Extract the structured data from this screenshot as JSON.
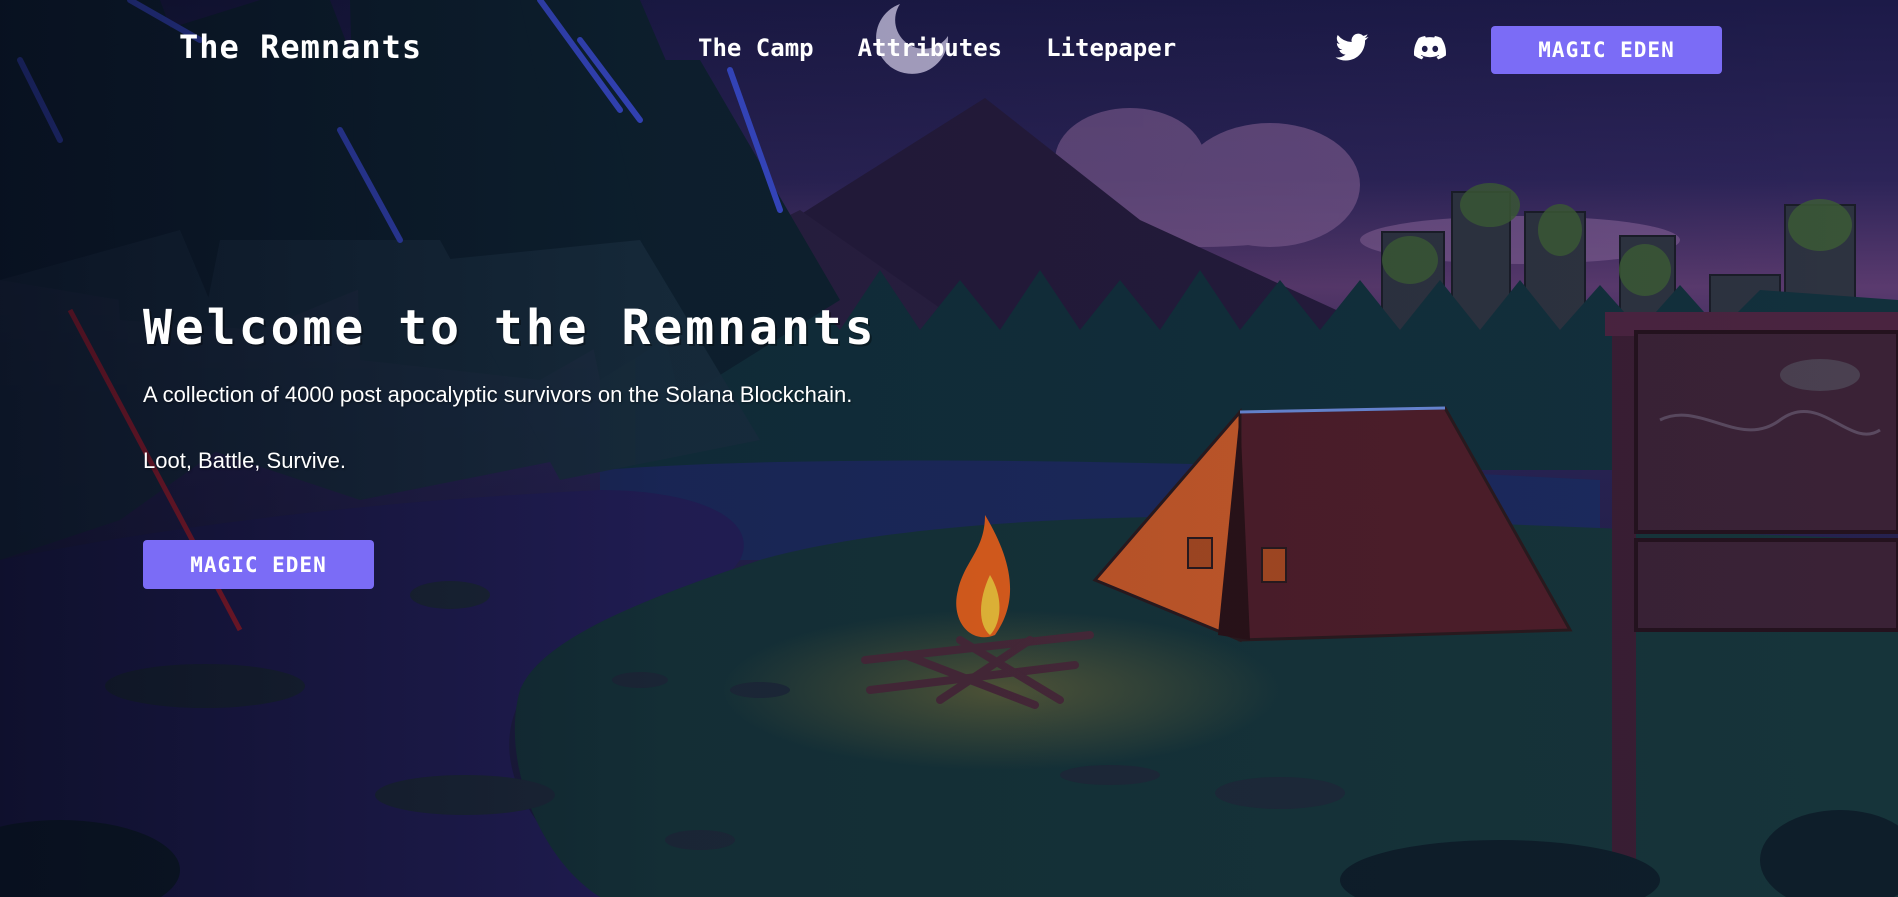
{
  "header": {
    "logo": "The Remnants",
    "nav": [
      "The Camp",
      "Attributes",
      "Litepaper"
    ],
    "social": [
      "twitter-icon",
      "discord-icon"
    ],
    "cta": "MAGIC EDEN"
  },
  "hero": {
    "title": "Welcome to the Remnants",
    "description": "A collection of 4000 post apocalyptic survivors on the Solana Blockchain.",
    "tagline": "Loot, Battle, Survive.",
    "cta": "MAGIC EDEN"
  },
  "colors": {
    "accent": "#7b6cf6",
    "sky_dark": "#1c1a48",
    "sky_dusk": "#5a3a6e",
    "forest": "#0d2a35",
    "tent": "#c85a2a",
    "fire": "#e8621c"
  }
}
